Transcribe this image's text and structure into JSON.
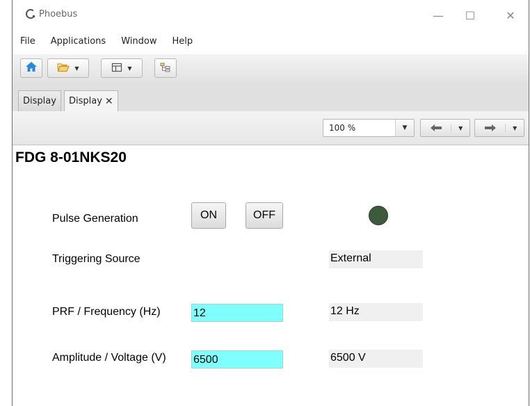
{
  "window": {
    "title": "Phoebus",
    "controls": {
      "minimize": "—",
      "maximize": "☐",
      "close": "✕"
    }
  },
  "menu": {
    "items": [
      "File",
      "Applications",
      "Window",
      "Help"
    ]
  },
  "toolbar": {
    "icons": [
      "home-icon",
      "open-folder-icon",
      "layout-icon",
      "tree-icon"
    ]
  },
  "tabs": [
    {
      "label": "Display",
      "closable": false
    },
    {
      "label": "Display",
      "closable": true,
      "close_glyph": "✕"
    }
  ],
  "display_toolbar": {
    "zoom": "100 %"
  },
  "panel": {
    "title": "FDG 8-01NKS20",
    "pulse_generation": {
      "label": "Pulse Generation",
      "on_label": "ON",
      "off_label": "OFF",
      "led_color": "#3c5a3c"
    },
    "triggering_source": {
      "label": "Triggering Source",
      "value": "External"
    },
    "prf": {
      "label": "PRF / Frequency (Hz)",
      "setpoint": "12",
      "readback": "12 Hz"
    },
    "amplitude": {
      "label": "Amplitude / Voltage (V)",
      "setpoint": "6500",
      "readback": "6500 V"
    }
  },
  "colors": {
    "entry_background": "#80ffff",
    "readback_background": "#f0f0f0",
    "home_icon": "#2a8ad4",
    "folder_icon": "#e1a21c"
  }
}
